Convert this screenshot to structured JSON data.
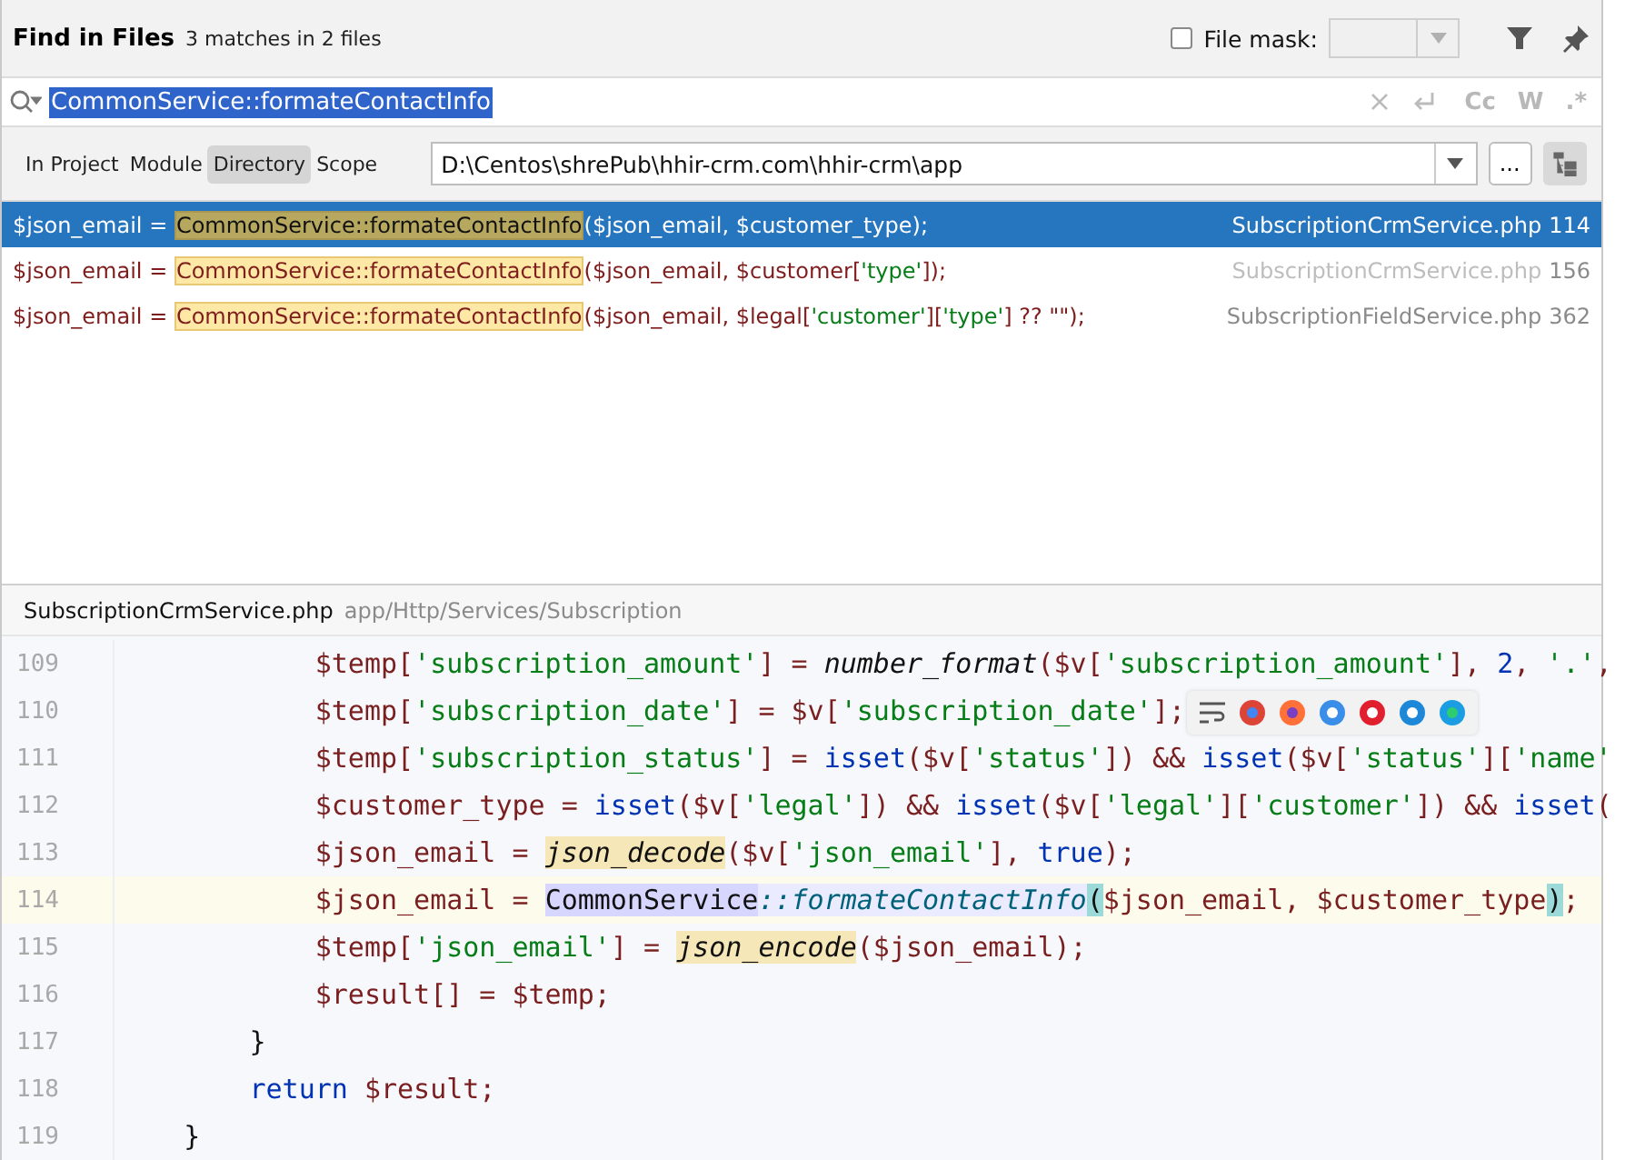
{
  "header": {
    "title": "Find in Files",
    "summary": "3 matches in 2 files",
    "file_mask": {
      "label": "File mask:",
      "checked": false
    }
  },
  "search": {
    "value": "CommonService::formateContactInfo",
    "toggles": [
      "Cc",
      "W",
      ".*"
    ]
  },
  "scope_tabs": [
    {
      "label": "In Project",
      "selected": false
    },
    {
      "label": "Module",
      "selected": false
    },
    {
      "label": "Directory",
      "selected": true
    },
    {
      "label": "Scope",
      "selected": false
    }
  ],
  "directory": {
    "value": "D:\\Centos\\shrePub\\hhir-crm.com\\hhir-crm\\app",
    "browse": "..."
  },
  "results": [
    {
      "prefix": "$json_email = ",
      "match": "CommonService::formateContactInfo",
      "suffix": [
        {
          "kind": "var",
          "text": "($json_email, $customer_type);"
        }
      ],
      "file": "SubscriptionCrmService.php",
      "line": "114",
      "selected": true,
      "file_dimmed": false
    },
    {
      "prefix": "$json_email = ",
      "match": "CommonService::formateContactInfo",
      "suffix": [
        {
          "kind": "var",
          "text": "($json_email, $customer["
        },
        {
          "kind": "str",
          "text": "'type'"
        },
        {
          "kind": "var",
          "text": "]);"
        }
      ],
      "file": "SubscriptionCrmService.php",
      "line": "156",
      "selected": false,
      "file_dimmed": true
    },
    {
      "prefix": "$json_email = ",
      "match": "CommonService::formateContactInfo",
      "suffix": [
        {
          "kind": "var",
          "text": "($json_email, $legal["
        },
        {
          "kind": "str",
          "text": "'customer'"
        },
        {
          "kind": "var",
          "text": "]["
        },
        {
          "kind": "str",
          "text": "'type'"
        },
        {
          "kind": "var",
          "text": "] ?? \"\");"
        }
      ],
      "file": "SubscriptionFieldService.php",
      "line": "362",
      "selected": false,
      "file_dimmed": false
    }
  ],
  "preview": {
    "file": "SubscriptionCrmService.php",
    "path": "app/Http/Services/Subscription"
  },
  "code_lines": [
    {
      "number": "109",
      "current": false,
      "segments": [
        {
          "kind": "var",
          "text": "            $temp["
        },
        {
          "kind": "str",
          "text": "'subscription_amount'"
        },
        {
          "kind": "var",
          "text": "] = "
        },
        {
          "kind": "fn",
          "text": "number_format"
        },
        {
          "kind": "var",
          "text": "($v["
        },
        {
          "kind": "str",
          "text": "'subscription_amount'"
        },
        {
          "kind": "var",
          "text": "], "
        },
        {
          "kind": "kw",
          "text": "2"
        },
        {
          "kind": "var",
          "text": ", "
        },
        {
          "kind": "str",
          "text": "'.'"
        },
        {
          "kind": "var",
          "text": ","
        }
      ]
    },
    {
      "number": "110",
      "current": false,
      "segments": [
        {
          "kind": "var",
          "text": "            $temp["
        },
        {
          "kind": "str",
          "text": "'subscription_date'"
        },
        {
          "kind": "var",
          "text": "] = $v["
        },
        {
          "kind": "str",
          "text": "'subscription_date'"
        },
        {
          "kind": "var",
          "text": "];"
        }
      ]
    },
    {
      "number": "111",
      "current": false,
      "segments": [
        {
          "kind": "var",
          "text": "            $temp["
        },
        {
          "kind": "str",
          "text": "'subscription_status'"
        },
        {
          "kind": "var",
          "text": "] = "
        },
        {
          "kind": "kw",
          "text": "isset"
        },
        {
          "kind": "var",
          "text": "($v["
        },
        {
          "kind": "str",
          "text": "'status'"
        },
        {
          "kind": "var",
          "text": "]) && "
        },
        {
          "kind": "kw",
          "text": "isset"
        },
        {
          "kind": "var",
          "text": "($v["
        },
        {
          "kind": "str",
          "text": "'status'"
        },
        {
          "kind": "var",
          "text": "]["
        },
        {
          "kind": "str",
          "text": "'name'"
        }
      ]
    },
    {
      "number": "112",
      "current": false,
      "segments": [
        {
          "kind": "var",
          "text": "            $customer_type = "
        },
        {
          "kind": "kw",
          "text": "isset"
        },
        {
          "kind": "var",
          "text": "($v["
        },
        {
          "kind": "str",
          "text": "'legal'"
        },
        {
          "kind": "var",
          "text": "]) && "
        },
        {
          "kind": "kw",
          "text": "isset"
        },
        {
          "kind": "var",
          "text": "($v["
        },
        {
          "kind": "str",
          "text": "'legal'"
        },
        {
          "kind": "var",
          "text": "]["
        },
        {
          "kind": "str",
          "text": "'customer'"
        },
        {
          "kind": "var",
          "text": "]) && "
        },
        {
          "kind": "kw",
          "text": "isset"
        },
        {
          "kind": "var",
          "text": "("
        }
      ]
    },
    {
      "number": "113",
      "current": false,
      "segments": [
        {
          "kind": "var",
          "text": "            $json_email = "
        },
        {
          "kind": "fn_hl",
          "text": "json_decode"
        },
        {
          "kind": "var",
          "text": "($v["
        },
        {
          "kind": "str",
          "text": "'json_email'"
        },
        {
          "kind": "var",
          "text": "], "
        },
        {
          "kind": "kw",
          "text": "true"
        },
        {
          "kind": "var",
          "text": ");"
        }
      ]
    },
    {
      "number": "114",
      "current": true,
      "segments": [
        {
          "kind": "var",
          "text": "            $json_email = "
        },
        {
          "kind": "class_hl",
          "text": "CommonService"
        },
        {
          "kind": "method_hl",
          "text": "::formateContactInfo"
        },
        {
          "kind": "brace",
          "text": "("
        },
        {
          "kind": "var",
          "text": "$json_email, $customer_type"
        },
        {
          "kind": "brace",
          "text": ")"
        },
        {
          "kind": "var",
          "text": ";"
        }
      ]
    },
    {
      "number": "115",
      "current": false,
      "segments": [
        {
          "kind": "var",
          "text": "            $temp["
        },
        {
          "kind": "str",
          "text": "'json_email'"
        },
        {
          "kind": "var",
          "text": "] = "
        },
        {
          "kind": "fn_hl",
          "text": "json_encode"
        },
        {
          "kind": "var",
          "text": "($json_email);"
        }
      ]
    },
    {
      "number": "116",
      "current": false,
      "segments": [
        {
          "kind": "var",
          "text": "            $result[] = $temp;"
        }
      ]
    },
    {
      "number": "117",
      "current": false,
      "segments": [
        {
          "kind": "plain",
          "text": "        }"
        }
      ]
    },
    {
      "number": "118",
      "current": false,
      "segments": [
        {
          "kind": "kw",
          "text": "        return"
        },
        {
          "kind": "var",
          "text": " $result;"
        }
      ]
    },
    {
      "number": "119",
      "current": false,
      "segments": [
        {
          "kind": "plain",
          "text": "    }"
        }
      ]
    }
  ]
}
